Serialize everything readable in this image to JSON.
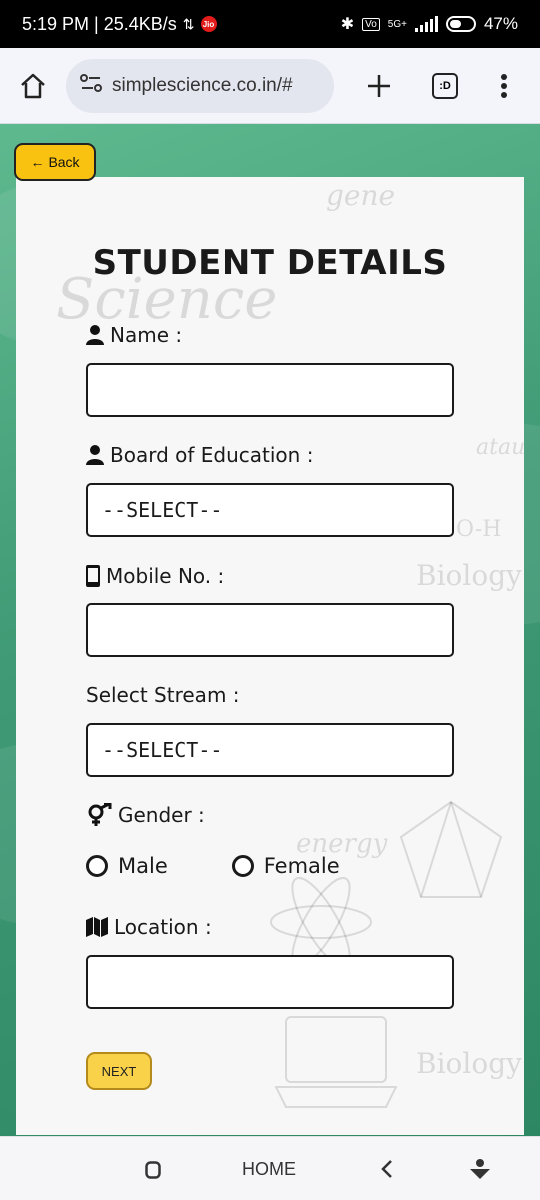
{
  "status_bar": {
    "time_speed": "5:19 PM | 25.4KB/s",
    "network": "5G+",
    "battery": "47%"
  },
  "browser": {
    "url": "simplescience.co.in/#",
    "tabs_label": ":D"
  },
  "page": {
    "back_label": "Back",
    "title": "STUDENT DETAILS",
    "fields": {
      "name_label": "Name :",
      "board_label": "Board of Education :",
      "board_value": "--SELECT--",
      "mobile_label": "Mobile No. :",
      "stream_label": "Select Stream :",
      "stream_value": "--SELECT--",
      "gender_label": "Gender :",
      "gender_options": [
        "Male",
        "Female"
      ],
      "location_label": "Location :"
    },
    "next_label": "NEXT",
    "background_doodles": [
      "Science",
      "gene",
      "Biology",
      "energy",
      "O-H",
      "atau",
      "Biology"
    ]
  },
  "nav": {
    "home_label": "HOME"
  }
}
